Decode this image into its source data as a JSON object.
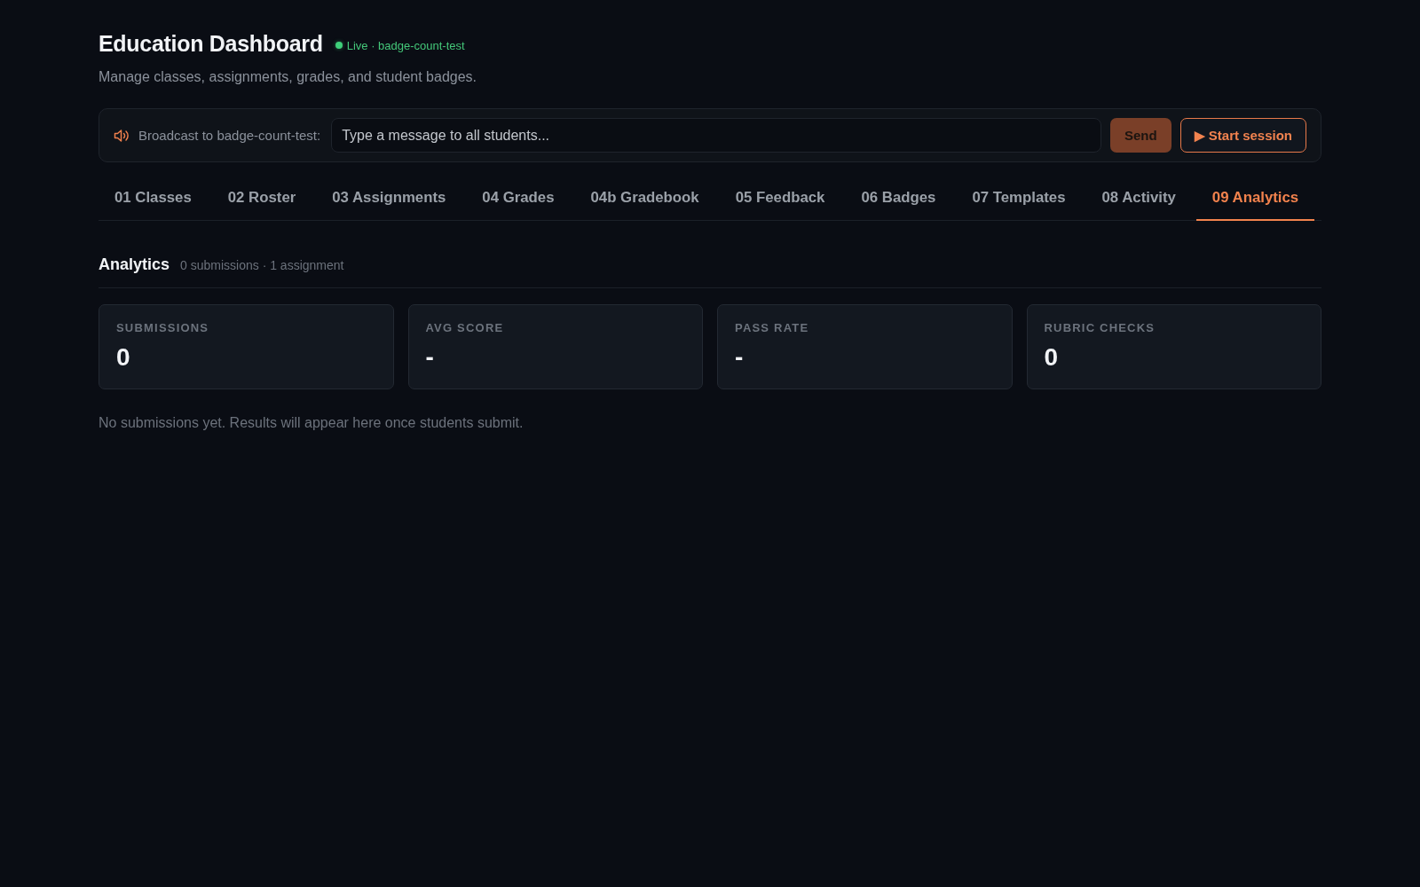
{
  "header": {
    "title": "Education Dashboard",
    "status": "Live · badge-count-test",
    "subtitle": "Manage classes, assignments, grades, and student badges."
  },
  "broadcast": {
    "label": "Broadcast to badge-count-test:",
    "placeholder": "Type a message to all students...",
    "send_button": "Send",
    "session_button": "▶ Start session"
  },
  "tabs": [
    {
      "label": "01 Classes",
      "selected": false
    },
    {
      "label": "02 Roster",
      "selected": false
    },
    {
      "label": "03 Assignments",
      "selected": false
    },
    {
      "label": "04 Grades",
      "selected": false
    },
    {
      "label": "04b Gradebook",
      "selected": false
    },
    {
      "label": "05 Feedback",
      "selected": false
    },
    {
      "label": "06 Badges",
      "selected": false
    },
    {
      "label": "07 Templates",
      "selected": false
    },
    {
      "label": "08 Activity",
      "selected": false
    },
    {
      "label": "09 Analytics",
      "selected": true
    }
  ],
  "section": {
    "title": "Analytics",
    "meta": "0 submissions · 1 assignment"
  },
  "stats": [
    {
      "label": "SUBMISSIONS",
      "value": "0"
    },
    {
      "label": "AVG SCORE",
      "value": "-"
    },
    {
      "label": "PASS RATE",
      "value": "-"
    },
    {
      "label": "RUBRIC CHECKS",
      "value": "0"
    }
  ],
  "empty_message": "No submissions yet. Results will appear here once students submit."
}
